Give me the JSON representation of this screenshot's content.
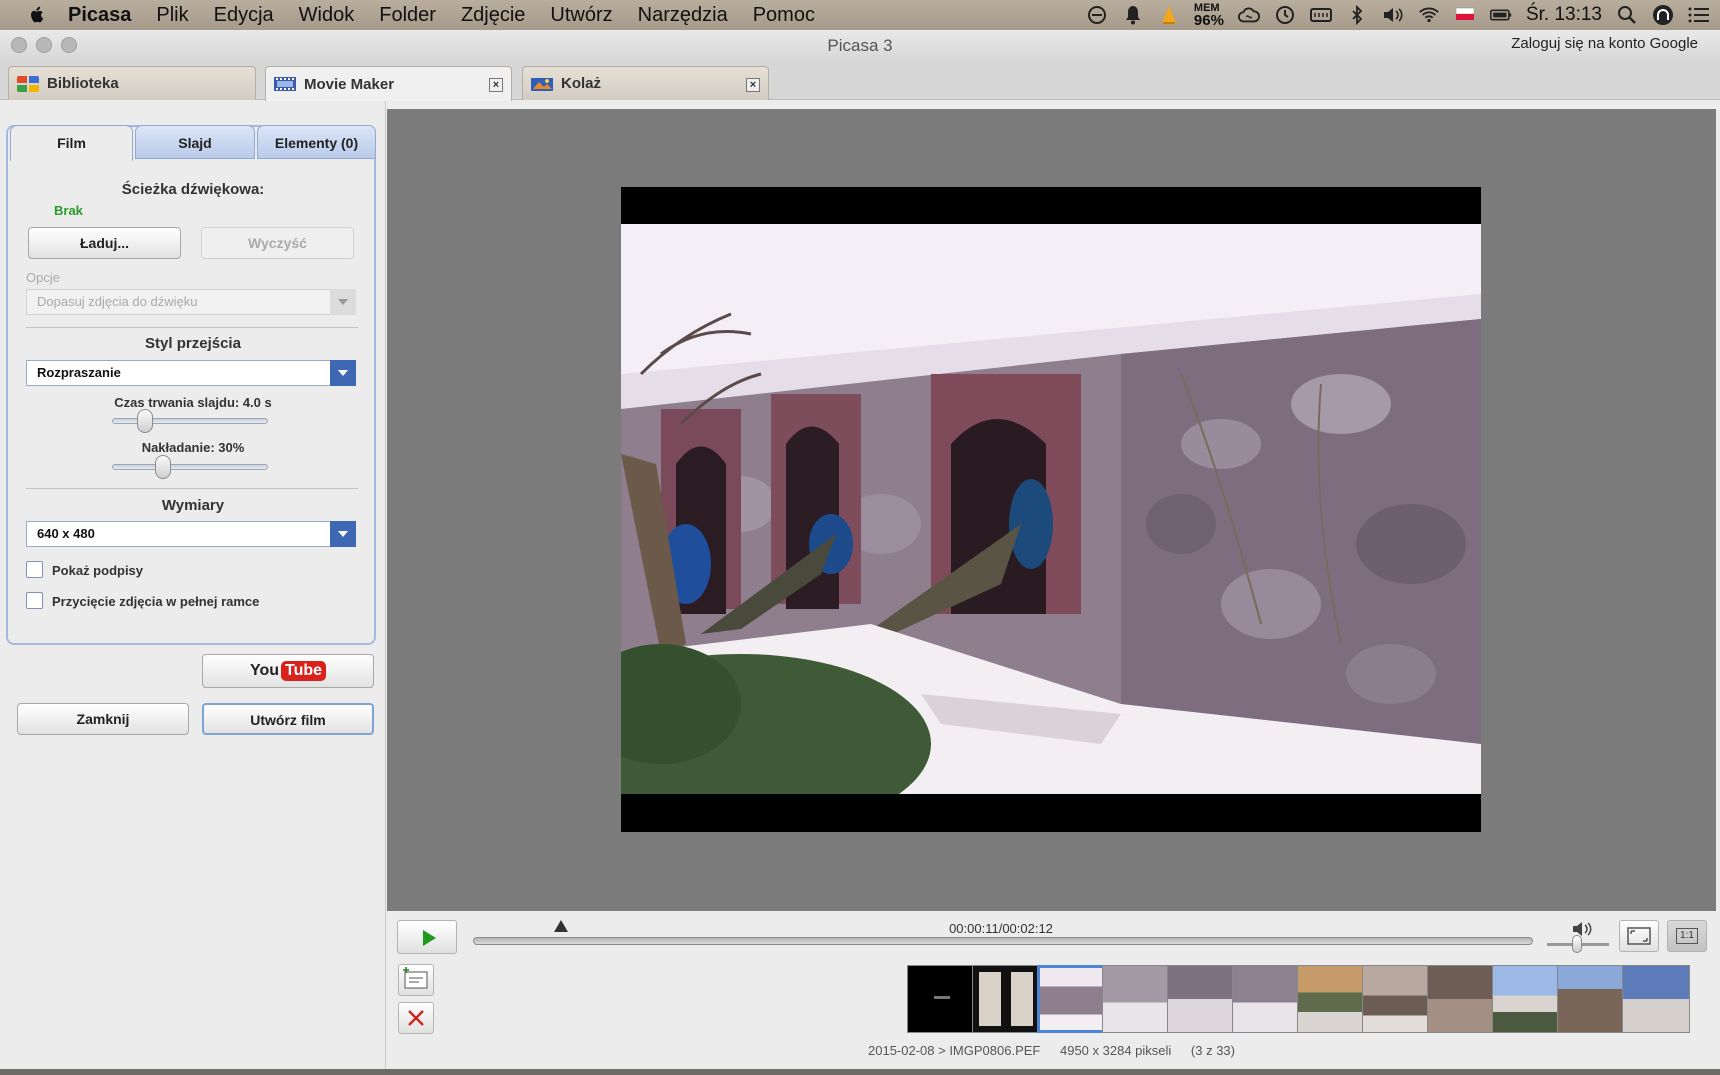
{
  "menubar": {
    "app": "Picasa",
    "items": [
      "Plik",
      "Edycja",
      "Widok",
      "Folder",
      "Zdjęcie",
      "Utwórz",
      "Narzędzia",
      "Pomoc"
    ],
    "mem_label": "MEM",
    "mem_value": "96%",
    "clock": "Śr. 13:13"
  },
  "window": {
    "title": "Picasa 3",
    "signin": "Zaloguj się na konto Google"
  },
  "tabs": [
    {
      "label": "Biblioteka"
    },
    {
      "label": "Movie Maker"
    },
    {
      "label": "Kolaż"
    }
  ],
  "close_glyph": "×",
  "panel": {
    "tabs": [
      "Film",
      "Slajd",
      "Elementy (0)"
    ],
    "audio_title": "Ścieżka dźwiękowa:",
    "audio_value": "Brak",
    "load_button": "Ładuj...",
    "clear_button": "Wyczyść",
    "options_label": "Opcje",
    "options_value": "Dopasuj zdjęcia do dźwięku",
    "transition_title": "Styl przejścia",
    "transition_value": "Rozpraszanie",
    "duration_label": "Czas trwania slajdu: 4.0 s",
    "duration_level": 0.17,
    "overlap_label": "Nakładanie: 30%",
    "overlap_level": 0.3,
    "dimensions_title": "Wymiary",
    "dimensions_value": "640 x 480",
    "show_captions": "Pokaż podpisy",
    "full_frame_crop": "Przycięcie zdjęcia w pełnej ramce",
    "youtube_you": "You",
    "youtube_tube": "Tube",
    "close_button": "Zamknij",
    "create_button": "Utwórz film"
  },
  "player": {
    "timecode": "00:00:11/00:02:12",
    "progress": 0.083,
    "zoom_label": "1:1"
  },
  "status": {
    "path": "2015-02-08 > IMGP0806.PEF",
    "size": "4950 x 3284 pikseli",
    "position": "(3 z 33)"
  },
  "colors": {
    "accent": "#3f68b4",
    "play": "#1f9a1f",
    "audio_value": "#2c9a2c",
    "youtube_red": "#d9221c"
  }
}
